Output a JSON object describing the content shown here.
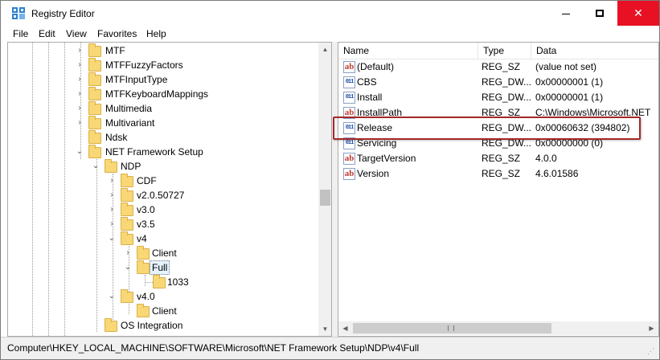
{
  "window": {
    "title": "Registry Editor",
    "icon": "registry-editor-icon",
    "close_color": "#e81123"
  },
  "menu": [
    "File",
    "Edit",
    "View",
    "Favorites",
    "Help"
  ],
  "tree": {
    "nodes": [
      {
        "label": "MTF",
        "expander": "›"
      },
      {
        "label": "MTFFuzzyFactors",
        "expander": "›"
      },
      {
        "label": "MTFInputType",
        "expander": "›"
      },
      {
        "label": "MTFKeyboardMappings",
        "expander": "›"
      },
      {
        "label": "Multimedia",
        "expander": "›"
      },
      {
        "label": "Multivariant",
        "expander": "›"
      },
      {
        "label": "Ndsk",
        "expander": ""
      },
      {
        "label": "NET Framework Setup",
        "expander": "⌄"
      },
      {
        "label": "NDP",
        "expander": "⌄"
      },
      {
        "label": "CDF",
        "expander": "›"
      },
      {
        "label": "v2.0.50727",
        "expander": "›"
      },
      {
        "label": "v3.0",
        "expander": "›"
      },
      {
        "label": "v3.5",
        "expander": "›"
      },
      {
        "label": "v4",
        "expander": "⌄"
      },
      {
        "label": "Client",
        "expander": "›"
      },
      {
        "label": "Full",
        "expander": "⌄",
        "selected": true
      },
      {
        "label": "1033",
        "expander": ""
      },
      {
        "label": "v4.0",
        "expander": "⌄"
      },
      {
        "label": "Client",
        "expander": ""
      },
      {
        "label": "OS Integration",
        "expander": ""
      }
    ]
  },
  "list": {
    "columns": [
      "Name",
      "Type",
      "Data"
    ],
    "rows": [
      {
        "name": "(Default)",
        "type": "REG_SZ",
        "data": "(value not set)",
        "icon": "string-value-icon"
      },
      {
        "name": "CBS",
        "type": "REG_DW...",
        "data": "0x00000001 (1)",
        "icon": "dword-value-icon"
      },
      {
        "name": "Install",
        "type": "REG_DW...",
        "data": "0x00000001 (1)",
        "icon": "dword-value-icon"
      },
      {
        "name": "InstallPath",
        "type": "REG_SZ",
        "data": "C:\\Windows\\Microsoft.NET",
        "icon": "string-value-icon"
      },
      {
        "name": "Release",
        "type": "REG_DW...",
        "data": "0x00060632 (394802)",
        "icon": "dword-value-icon",
        "highlighted": true
      },
      {
        "name": "Servicing",
        "type": "REG_DW...",
        "data": "0x00000000 (0)",
        "icon": "dword-value-icon"
      },
      {
        "name": "TargetVersion",
        "type": "REG_SZ",
        "data": "4.0.0",
        "icon": "string-value-icon"
      },
      {
        "name": "Version",
        "type": "REG_SZ",
        "data": "4.6.01586",
        "icon": "string-value-icon"
      }
    ],
    "icon_glyphs": {
      "string": "ab",
      "dword": "011"
    },
    "highlight_color": "#a52828"
  },
  "status": {
    "path": "Computer\\HKEY_LOCAL_MACHINE\\SOFTWARE\\Microsoft\\NET Framework Setup\\NDP\\v4\\Full"
  }
}
